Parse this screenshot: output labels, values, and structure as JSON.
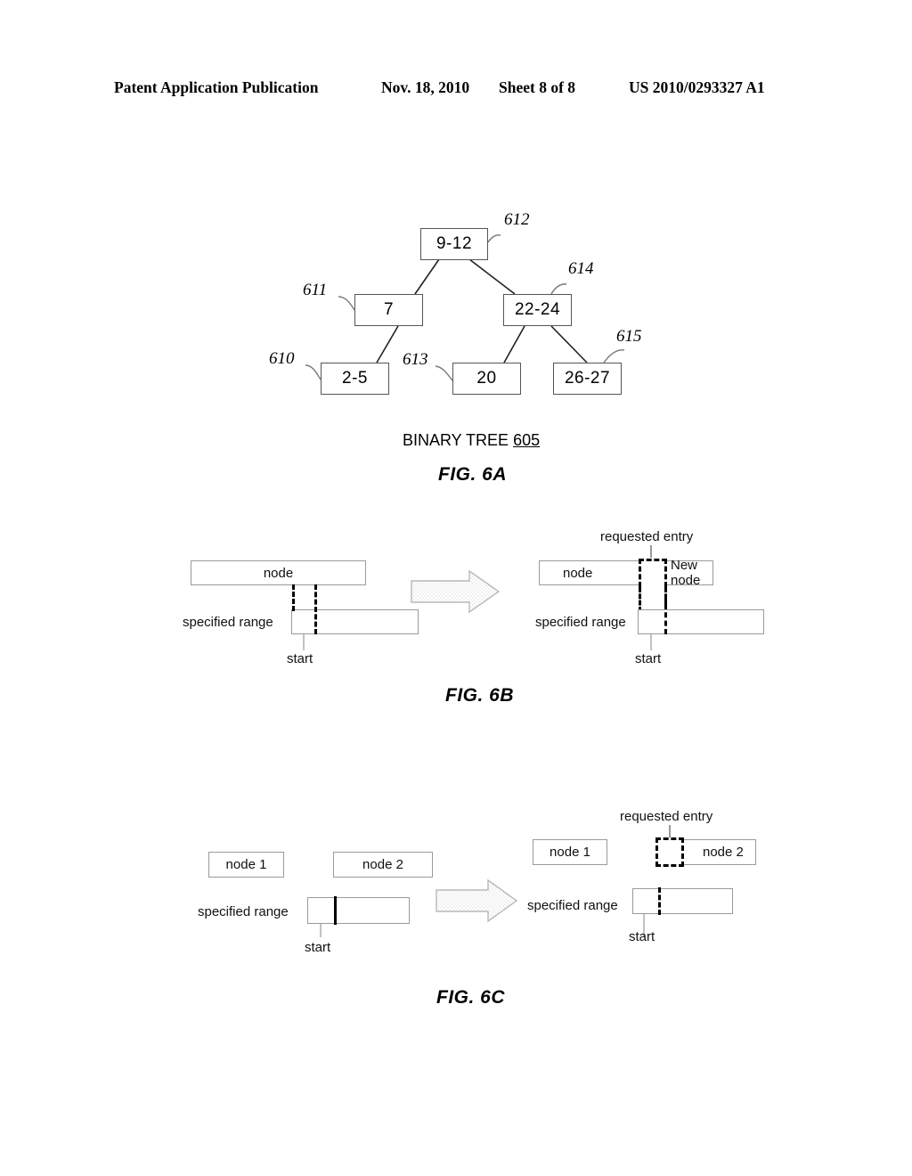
{
  "header": {
    "title": "Patent Application Publication",
    "date": "Nov. 18, 2010",
    "sheet": "Sheet 8 of 8",
    "pub_number": "US 2010/0293327 A1"
  },
  "fig6a": {
    "caption": "FIG. 6A",
    "label_text": "BINARY TREE ",
    "label_ref": "605",
    "nodes": [
      {
        "id": "root",
        "text": "9-12",
        "ref": "612"
      },
      {
        "id": "left",
        "text": "7",
        "ref": "611"
      },
      {
        "id": "right",
        "text": "22-24",
        "ref": "614"
      },
      {
        "id": "ll",
        "text": "2-5",
        "ref": "610"
      },
      {
        "id": "rl",
        "text": "20",
        "ref": "613"
      },
      {
        "id": "rr",
        "text": "26-27",
        "ref": "615"
      }
    ]
  },
  "fig6b": {
    "caption": "FIG. 6B",
    "before": {
      "node_label": "node",
      "range_label": "specified range",
      "start_label": "start"
    },
    "after": {
      "requested_entry_label": "requested entry",
      "node_label": "node",
      "new_node_label": "New node",
      "range_label": "specified range",
      "start_label": "start"
    }
  },
  "fig6c": {
    "caption": "FIG. 6C",
    "before": {
      "node1_label": "node 1",
      "node2_label": "node 2",
      "range_label": "specified range",
      "start_label": "start"
    },
    "after": {
      "requested_entry_label": "requested entry",
      "node1_label": "node 1",
      "node2_label": "node 2",
      "range_label": "specified range",
      "start_label": "start"
    }
  },
  "colors": {
    "ink": "#000000",
    "box_outline": "#555555",
    "light_outline": "#9a9a9a",
    "arrow_fill": "#f2f2f2",
    "arrow_stroke": "#b5b5b5",
    "thin_gray": "#8d8d8d"
  }
}
